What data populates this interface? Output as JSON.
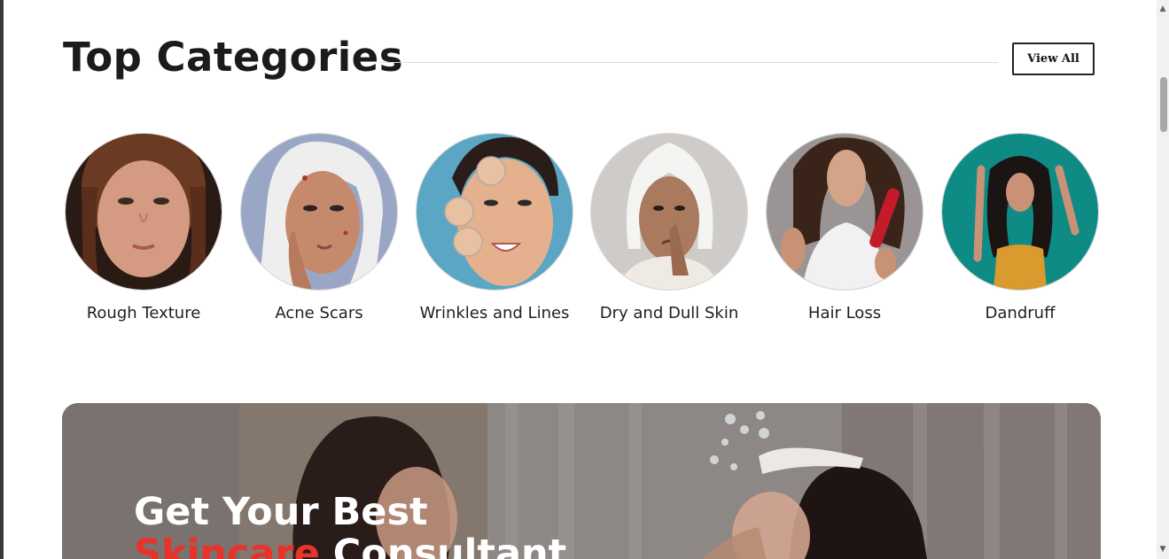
{
  "section": {
    "title": "Top Categories",
    "view_all_label": "View All"
  },
  "categories": [
    {
      "label": "Rough Texture",
      "icon": "portrait-rough-texture"
    },
    {
      "label": "Acne Scars",
      "icon": "portrait-acne-scars"
    },
    {
      "label": "Wrinkles and Lines",
      "icon": "portrait-wrinkles"
    },
    {
      "label": "Dry and Dull Skin",
      "icon": "portrait-dry-skin"
    },
    {
      "label": "Hair Loss",
      "icon": "portrait-hair-loss"
    },
    {
      "label": "Dandruff",
      "icon": "portrait-dandruff"
    }
  ],
  "banner": {
    "line1": "Get Your Best",
    "line2_accent": "Skincare",
    "line2_rest": " Consultant"
  },
  "colors": {
    "accent": "#e8322a",
    "heading": "#1b1b1b",
    "banner_text": "#ffffff"
  },
  "scrollbar": {
    "up_icon": "triangle-up-icon",
    "down_icon": "triangle-down-icon"
  }
}
